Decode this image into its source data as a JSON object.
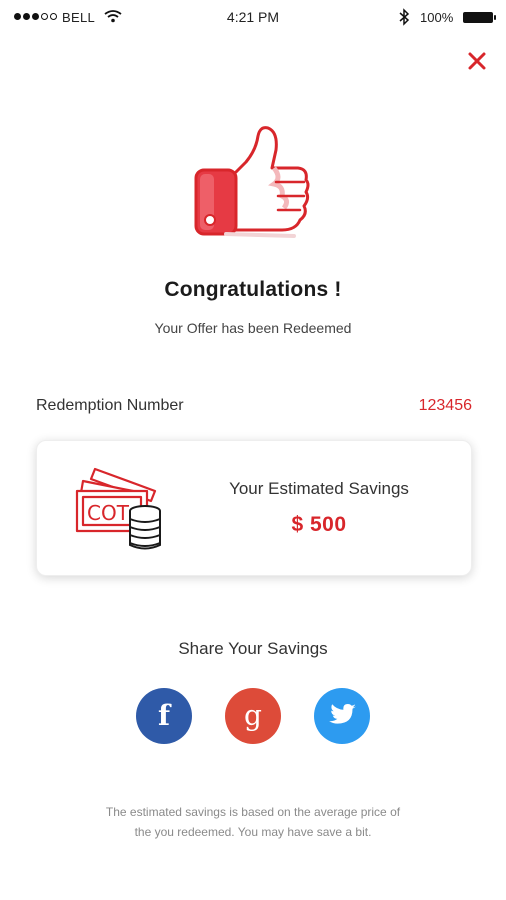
{
  "status_bar": {
    "carrier": "BELL",
    "time": "4:21 PM",
    "battery": "100%"
  },
  "icons": {
    "close": "close-icon",
    "thumb": "thumbs-up-icon",
    "money": "money-coins-icon",
    "facebook": "facebook-icon",
    "google": "google-plus-icon",
    "twitter": "twitter-icon"
  },
  "header": {
    "title": "Congratulations !",
    "subtitle": "Your Offer has been Redeemed"
  },
  "redemption": {
    "label": "Redemption Number",
    "number": "123456"
  },
  "savings_card": {
    "title": "Your Estimated Savings",
    "value": "$ 500"
  },
  "share": {
    "title": "Share Your Savings",
    "facebook_glyph": "f",
    "google_glyph": "g"
  },
  "disclaimer": {
    "line1": "The estimated savings is based on the average price of",
    "line2": "the you redeemed. You may have save a bit."
  },
  "colors": {
    "accent": "#d8262b",
    "facebook": "#2f5aa8",
    "google": "#dd4b39",
    "twitter": "#2d9bf0"
  }
}
